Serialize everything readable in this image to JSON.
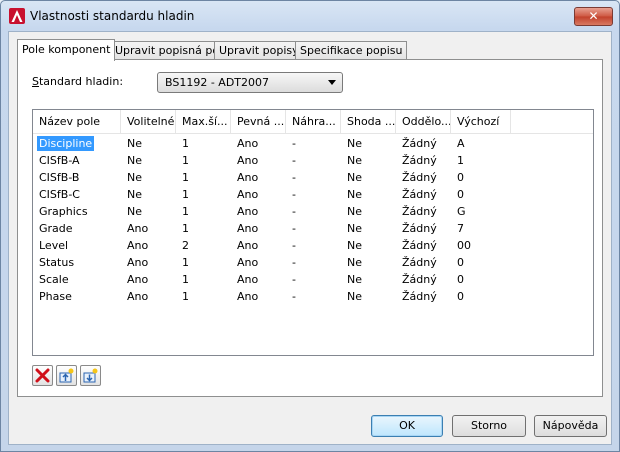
{
  "window": {
    "title": "Vlastnosti standardu hladin",
    "close_label": "✕"
  },
  "tabs": [
    {
      "label": "Pole komponent",
      "active": true
    },
    {
      "label": "Upravit popisná pole",
      "active": false
    },
    {
      "label": "Upravit popisy",
      "active": false
    },
    {
      "label": "Specifikace popisu",
      "active": false
    }
  ],
  "standard": {
    "label_accel": "S",
    "label_rest": "tandard hladin:",
    "value": "BS1192 - ADT2007"
  },
  "table": {
    "columns": [
      "Název pole",
      "Volitelné",
      "Max.ší...",
      "Pevná ...",
      "Náhra...",
      "Shoda ...",
      "Oddělo...",
      "Výchozí"
    ],
    "rows": [
      [
        "Discipline",
        "Ne",
        "1",
        "Ano",
        "-",
        "Ne",
        "Žádný",
        "A"
      ],
      [
        "CISfB-A",
        "Ne",
        "1",
        "Ano",
        "-",
        "Ne",
        "Žádný",
        "1"
      ],
      [
        "CISfB-B",
        "Ne",
        "1",
        "Ano",
        "-",
        "Ne",
        "Žádný",
        "0"
      ],
      [
        "CISfB-C",
        "Ne",
        "1",
        "Ano",
        "-",
        "Ne",
        "Žádný",
        "0"
      ],
      [
        "Graphics",
        "Ne",
        "1",
        "Ano",
        "-",
        "Ne",
        "Žádný",
        "G"
      ],
      [
        "Grade",
        "Ano",
        "1",
        "Ano",
        "-",
        "Ne",
        "Žádný",
        "7"
      ],
      [
        "Level",
        "Ano",
        "2",
        "Ano",
        "-",
        "Ne",
        "Žádný",
        "00"
      ],
      [
        "Status",
        "Ano",
        "1",
        "Ano",
        "-",
        "Ne",
        "Žádný",
        "0"
      ],
      [
        "Scale",
        "Ano",
        "1",
        "Ano",
        "-",
        "Ne",
        "Žádný",
        "0"
      ],
      [
        "Phase",
        "Ano",
        "1",
        "Ano",
        "-",
        "Ne",
        "Žádný",
        "0"
      ]
    ],
    "selected_row": 0
  },
  "toolbar": {
    "icons": [
      "delete-icon",
      "move-up-icon",
      "move-down-icon"
    ]
  },
  "buttons": {
    "ok": "OK",
    "cancel": "Storno",
    "help": "Nápověda"
  }
}
